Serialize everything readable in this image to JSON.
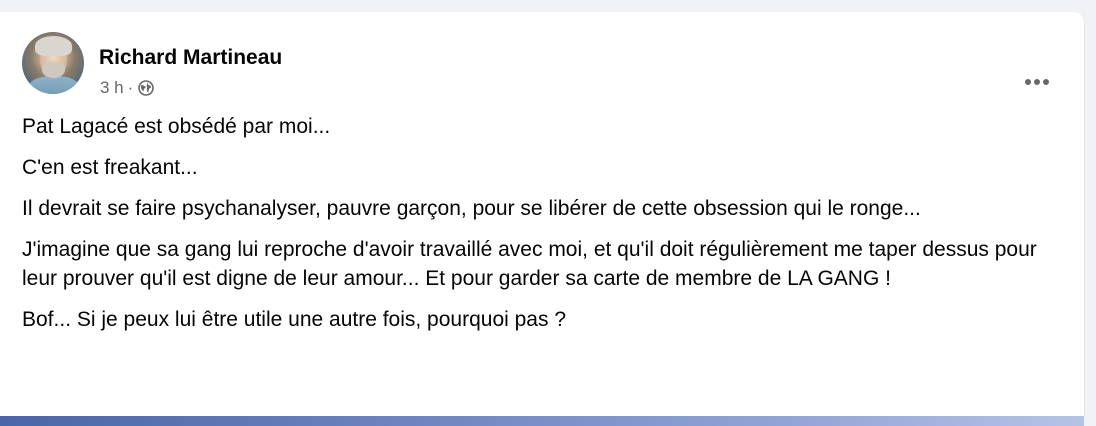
{
  "post": {
    "author": {
      "name": "Richard Martineau",
      "avatar_icon": "profile-photo"
    },
    "meta": {
      "time": "3 h",
      "separator": "·",
      "privacy_icon": "globe-icon"
    },
    "more_options_icon": "more-horizontal-icon",
    "paragraphs": [
      "Pat Lagacé est obsédé par moi...",
      "C'en est freakant...",
      "Il devrait se faire psychanalyser, pauvre garçon, pour se libérer de cette obsession qui le ronge...",
      "J'imagine que sa gang lui reproche d'avoir travaillé avec moi, et qu'il doit régulièrement me taper dessus pour leur prouver qu'il est digne de leur amour... Et pour garder sa carte de membre de LA GANG !",
      "Bof... Si je peux lui être utile une autre fois, pourquoi pas ?"
    ]
  },
  "colors": {
    "page_background": "#f0f2f5",
    "card_background": "#ffffff",
    "primary_text": "#050505",
    "secondary_text": "#65676b"
  }
}
